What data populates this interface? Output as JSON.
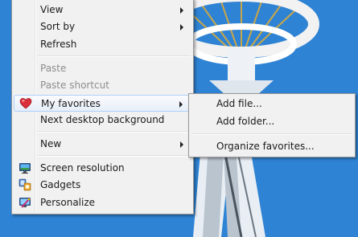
{
  "desktop": {
    "wallpaper_icon": "space-needle-wallpaper"
  },
  "context_menu": {
    "items": [
      {
        "label": "View",
        "submenu": true,
        "enabled": true
      },
      {
        "label": "Sort by",
        "submenu": true,
        "enabled": true
      },
      {
        "label": "Refresh",
        "submenu": false,
        "enabled": true
      },
      {
        "label": "Paste",
        "submenu": false,
        "enabled": false
      },
      {
        "label": "Paste shortcut",
        "submenu": false,
        "enabled": false
      },
      {
        "label": "My favorites",
        "submenu": true,
        "enabled": true,
        "highlighted": true,
        "icon": "heart-icon"
      },
      {
        "label": "Next desktop background",
        "submenu": false,
        "enabled": true
      },
      {
        "label": "New",
        "submenu": true,
        "enabled": true
      },
      {
        "label": "Screen resolution",
        "submenu": false,
        "enabled": true,
        "icon": "monitor-icon"
      },
      {
        "label": "Gadgets",
        "submenu": false,
        "enabled": true,
        "icon": "gadgets-icon"
      },
      {
        "label": "Personalize",
        "submenu": false,
        "enabled": true,
        "icon": "personalize-icon"
      }
    ]
  },
  "favorites_submenu": {
    "items": [
      {
        "label": "Add file..."
      },
      {
        "label": "Add folder..."
      },
      {
        "label": "Organize favorites..."
      }
    ]
  },
  "colors": {
    "menu_background": "#f1f1f1",
    "highlight_border": "#aecff7",
    "disabled_text": "#8d8d8d",
    "sky": "#3a8fdc"
  }
}
